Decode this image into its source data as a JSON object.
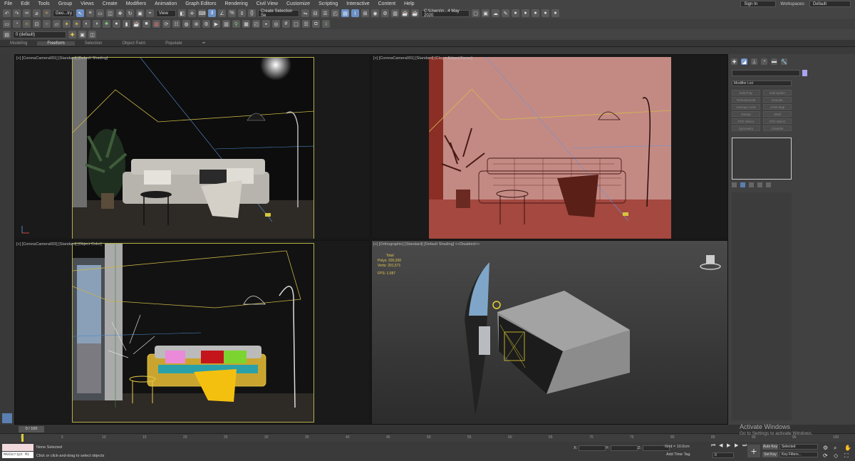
{
  "menu": [
    "File",
    "Edit",
    "Tools",
    "Group",
    "Views",
    "Create",
    "Modifiers",
    "Animation",
    "Graph Editors",
    "Rendering",
    "Civil View",
    "Customize",
    "Scripting",
    "Interactive",
    "Content",
    "Help"
  ],
  "account": {
    "signin": "Sign In",
    "workspaces_label": "Workspaces:",
    "workspace": "Default"
  },
  "toolbar": {
    "filter_dd": "Geo...try",
    "view_dd": "View",
    "create_sel": "Create Selection Se",
    "path_dd": "C:\\Users\\n...4 May 2020",
    "layer_dd": "0 (default)"
  },
  "ribbon_tabs": [
    "Modeling",
    "Freeform",
    "Selection",
    "Object Paint",
    "Populate"
  ],
  "viewports": [
    {
      "label": "[+] [CoronaCamera001] [Standard] [Default Shading]"
    },
    {
      "label": "[+] [CoronaCamera001] [Standard] [Clay + Edged Faces]"
    },
    {
      "label": "[+] [CoronaCamera003] [Standard] [Object Color]"
    },
    {
      "label": "[+] [Orthographic] [Standard] [Default Shading]  <<Disabled>>"
    }
  ],
  "stats": {
    "total": "Total",
    "polys_label": "Polys:",
    "polys": "200,200",
    "verts_label": "Verts:",
    "verts": "201,571",
    "fps_label": "FPS:",
    "fps": "1.087"
  },
  "cmd": {
    "modifier_list": "Modifier List",
    "buttons": [
      "Edit Poly",
      "Edit Spline",
      "TurboSmooth",
      "Extrude",
      "Unwrap UVW",
      "UVW Map",
      "Sweep",
      "Shell",
      "FFD Select",
      "FFD Select",
      "Symmetry",
      "Chamfer"
    ]
  },
  "timeline": {
    "frame": "0 / 100",
    "ticks": [
      "0",
      "5",
      "10",
      "15",
      "20",
      "25",
      "30",
      "35",
      "40",
      "45",
      "50",
      "55",
      "60",
      "65",
      "70",
      "75",
      "80",
      "85",
      "90",
      "95",
      "100"
    ]
  },
  "status": {
    "maxscript": "MAXScript Mi",
    "selection": "None Selected",
    "hint": "Click or click-and-drag to select objects",
    "x_label": "X:",
    "y_label": "Y:",
    "z_label": "Z:",
    "grid": "Grid = 10.0cm",
    "add_time_tag": "Add Time Tag",
    "autokey": "Auto Key",
    "setkey": "Set Key",
    "selected": "Selected",
    "key_filters": "Key Filters...",
    "frame_val": "0"
  },
  "watermark": {
    "line1": "Activate Windows",
    "line2": "Go to Settings to activate Windows."
  }
}
